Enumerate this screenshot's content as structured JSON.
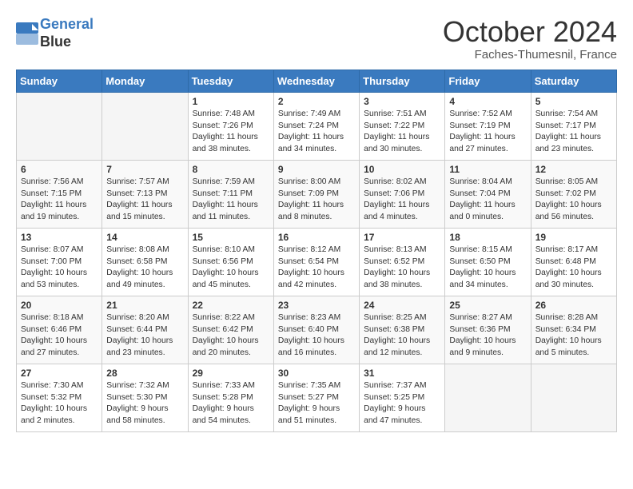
{
  "header": {
    "logo_line1": "General",
    "logo_line2": "Blue",
    "month": "October 2024",
    "location": "Faches-Thumesnil, France"
  },
  "weekdays": [
    "Sunday",
    "Monday",
    "Tuesday",
    "Wednesday",
    "Thursday",
    "Friday",
    "Saturday"
  ],
  "weeks": [
    [
      {
        "day": null,
        "empty": true
      },
      {
        "day": null,
        "empty": true
      },
      {
        "day": "1",
        "sunrise": "7:48 AM",
        "sunset": "7:26 PM",
        "daylight": "11 hours and 38 minutes."
      },
      {
        "day": "2",
        "sunrise": "7:49 AM",
        "sunset": "7:24 PM",
        "daylight": "11 hours and 34 minutes."
      },
      {
        "day": "3",
        "sunrise": "7:51 AM",
        "sunset": "7:22 PM",
        "daylight": "11 hours and 30 minutes."
      },
      {
        "day": "4",
        "sunrise": "7:52 AM",
        "sunset": "7:19 PM",
        "daylight": "11 hours and 27 minutes."
      },
      {
        "day": "5",
        "sunrise": "7:54 AM",
        "sunset": "7:17 PM",
        "daylight": "11 hours and 23 minutes."
      }
    ],
    [
      {
        "day": "6",
        "sunrise": "7:56 AM",
        "sunset": "7:15 PM",
        "daylight": "11 hours and 19 minutes."
      },
      {
        "day": "7",
        "sunrise": "7:57 AM",
        "sunset": "7:13 PM",
        "daylight": "11 hours and 15 minutes."
      },
      {
        "day": "8",
        "sunrise": "7:59 AM",
        "sunset": "7:11 PM",
        "daylight": "11 hours and 11 minutes."
      },
      {
        "day": "9",
        "sunrise": "8:00 AM",
        "sunset": "7:09 PM",
        "daylight": "11 hours and 8 minutes."
      },
      {
        "day": "10",
        "sunrise": "8:02 AM",
        "sunset": "7:06 PM",
        "daylight": "11 hours and 4 minutes."
      },
      {
        "day": "11",
        "sunrise": "8:04 AM",
        "sunset": "7:04 PM",
        "daylight": "11 hours and 0 minutes."
      },
      {
        "day": "12",
        "sunrise": "8:05 AM",
        "sunset": "7:02 PM",
        "daylight": "10 hours and 56 minutes."
      }
    ],
    [
      {
        "day": "13",
        "sunrise": "8:07 AM",
        "sunset": "7:00 PM",
        "daylight": "10 hours and 53 minutes."
      },
      {
        "day": "14",
        "sunrise": "8:08 AM",
        "sunset": "6:58 PM",
        "daylight": "10 hours and 49 minutes."
      },
      {
        "day": "15",
        "sunrise": "8:10 AM",
        "sunset": "6:56 PM",
        "daylight": "10 hours and 45 minutes."
      },
      {
        "day": "16",
        "sunrise": "8:12 AM",
        "sunset": "6:54 PM",
        "daylight": "10 hours and 42 minutes."
      },
      {
        "day": "17",
        "sunrise": "8:13 AM",
        "sunset": "6:52 PM",
        "daylight": "10 hours and 38 minutes."
      },
      {
        "day": "18",
        "sunrise": "8:15 AM",
        "sunset": "6:50 PM",
        "daylight": "10 hours and 34 minutes."
      },
      {
        "day": "19",
        "sunrise": "8:17 AM",
        "sunset": "6:48 PM",
        "daylight": "10 hours and 30 minutes."
      }
    ],
    [
      {
        "day": "20",
        "sunrise": "8:18 AM",
        "sunset": "6:46 PM",
        "daylight": "10 hours and 27 minutes."
      },
      {
        "day": "21",
        "sunrise": "8:20 AM",
        "sunset": "6:44 PM",
        "daylight": "10 hours and 23 minutes."
      },
      {
        "day": "22",
        "sunrise": "8:22 AM",
        "sunset": "6:42 PM",
        "daylight": "10 hours and 20 minutes."
      },
      {
        "day": "23",
        "sunrise": "8:23 AM",
        "sunset": "6:40 PM",
        "daylight": "10 hours and 16 minutes."
      },
      {
        "day": "24",
        "sunrise": "8:25 AM",
        "sunset": "6:38 PM",
        "daylight": "10 hours and 12 minutes."
      },
      {
        "day": "25",
        "sunrise": "8:27 AM",
        "sunset": "6:36 PM",
        "daylight": "10 hours and 9 minutes."
      },
      {
        "day": "26",
        "sunrise": "8:28 AM",
        "sunset": "6:34 PM",
        "daylight": "10 hours and 5 minutes."
      }
    ],
    [
      {
        "day": "27",
        "sunrise": "7:30 AM",
        "sunset": "5:32 PM",
        "daylight": "10 hours and 2 minutes."
      },
      {
        "day": "28",
        "sunrise": "7:32 AM",
        "sunset": "5:30 PM",
        "daylight": "9 hours and 58 minutes."
      },
      {
        "day": "29",
        "sunrise": "7:33 AM",
        "sunset": "5:28 PM",
        "daylight": "9 hours and 54 minutes."
      },
      {
        "day": "30",
        "sunrise": "7:35 AM",
        "sunset": "5:27 PM",
        "daylight": "9 hours and 51 minutes."
      },
      {
        "day": "31",
        "sunrise": "7:37 AM",
        "sunset": "5:25 PM",
        "daylight": "9 hours and 47 minutes."
      },
      {
        "day": null,
        "empty": true
      },
      {
        "day": null,
        "empty": true
      }
    ]
  ]
}
